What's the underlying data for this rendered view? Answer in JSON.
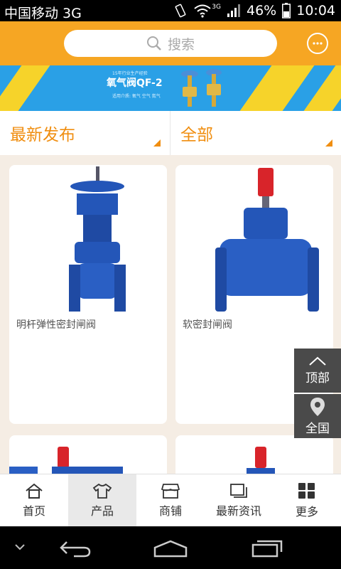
{
  "status": {
    "carrier": "中国移动 3G",
    "network": "3G",
    "battery": "46%",
    "time": "10:04"
  },
  "search": {
    "placeholder": "搜索"
  },
  "banner": {
    "title": "氧气阀QF-2",
    "top_note": "15年行业生产经验",
    "sub_note": "适用介质: 氧气 空气 氮气"
  },
  "filters": {
    "sort": "最新发布",
    "category": "全部"
  },
  "products": [
    {
      "name": "明杆弹性密封闸阀"
    },
    {
      "name": "软密封闸阀"
    }
  ],
  "float": {
    "top": "顶部",
    "region": "全国"
  },
  "tabs": [
    {
      "label": "首页",
      "icon": "home-icon"
    },
    {
      "label": "产品",
      "icon": "shirt-icon"
    },
    {
      "label": "商铺",
      "icon": "shop-icon"
    },
    {
      "label": "最新资讯",
      "icon": "news-icon"
    },
    {
      "label": "更多",
      "icon": "grid-icon"
    }
  ],
  "colors": {
    "accent": "#f6a623",
    "label_orange": "#f08e10",
    "valve_blue": "#2456b8",
    "cap_red": "#d8242a"
  }
}
